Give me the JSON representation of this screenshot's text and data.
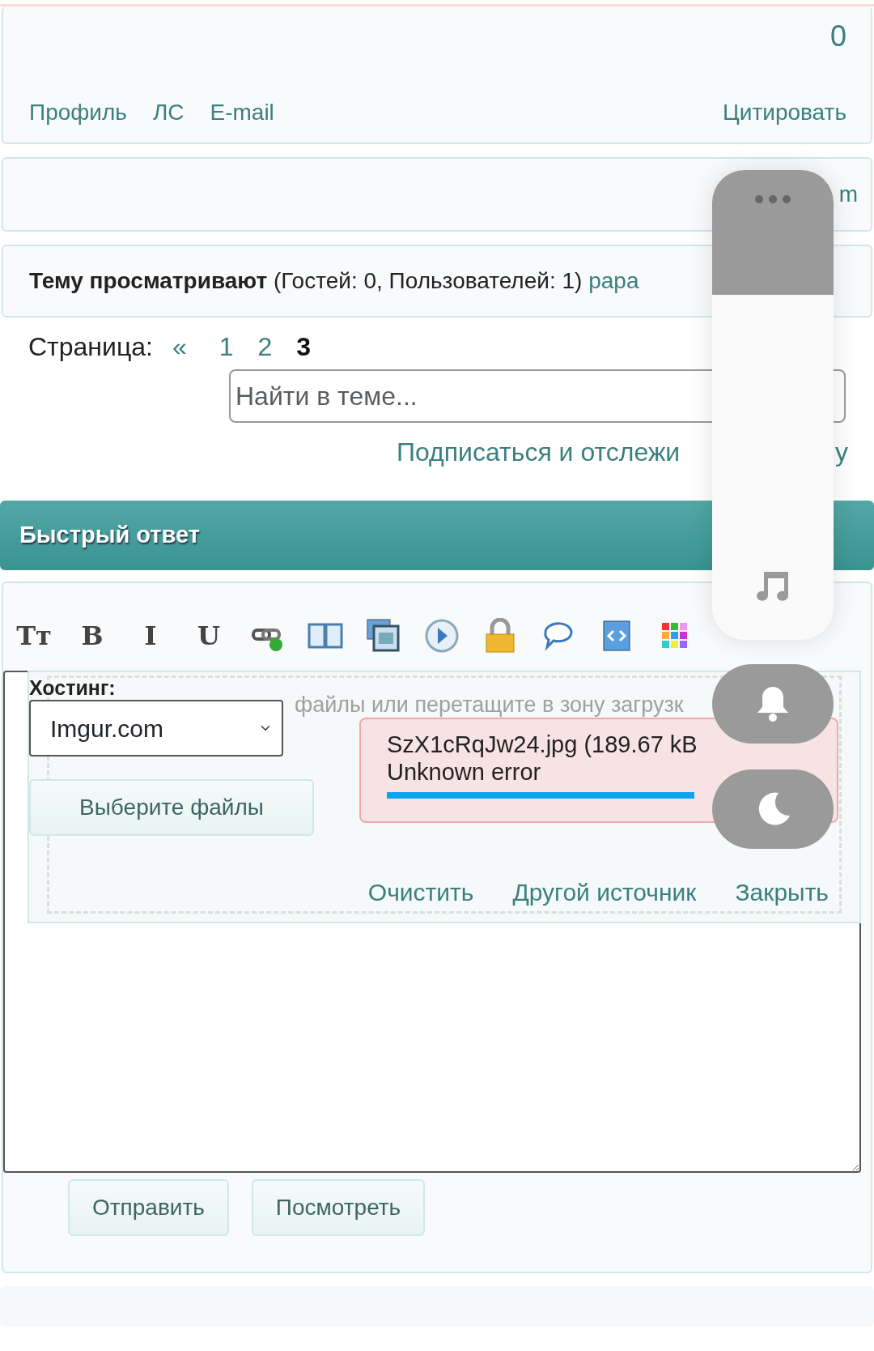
{
  "post": {
    "count": "0",
    "links": [
      "Профиль",
      "ЛС",
      "E-mail"
    ],
    "quote": "Цитировать"
  },
  "signature_fragment": "m",
  "viewers": {
    "label": "Тему просматривают",
    "counts": "(Гостей: 0, Пользователей: 1)",
    "user_fragment": "рара"
  },
  "pagination": {
    "label": "Страница:",
    "prev": "«",
    "pages": [
      {
        "label": "1",
        "selected": false
      },
      {
        "label": "2",
        "selected": false
      },
      {
        "label": "3",
        "selected": true
      }
    ]
  },
  "search": {
    "placeholder": "Найти в теме..."
  },
  "subscribe": {
    "left": "Подписаться и отслежи",
    "right": "у"
  },
  "quick_reply": {
    "title": "Быстрый ответ",
    "toolbar": [
      {
        "kind": "glyph",
        "label": "Tт"
      },
      {
        "kind": "glyph",
        "label": "B"
      },
      {
        "kind": "glyph",
        "label": "I"
      },
      {
        "kind": "glyph",
        "label": "U"
      },
      {
        "kind": "link"
      },
      {
        "kind": "book"
      },
      {
        "kind": "images"
      },
      {
        "kind": "play"
      },
      {
        "kind": "lock"
      },
      {
        "kind": "speech"
      },
      {
        "kind": "code"
      },
      {
        "kind": "colors"
      }
    ],
    "upload": {
      "hosting_label": "Хостинг:",
      "hosting_value": "Imgur.com",
      "drop_hint": "файлы или перетащите в зону загрузк",
      "choose": "Выберите файлы",
      "file": "SzX1cRqJw24.jpg (189.67 kB",
      "error": "Unknown error",
      "level": 1,
      "actions": [
        "Очистить",
        "Другой источник",
        "Закрыть"
      ]
    },
    "buttons": [
      "Отправить",
      "Посмотреть"
    ]
  }
}
